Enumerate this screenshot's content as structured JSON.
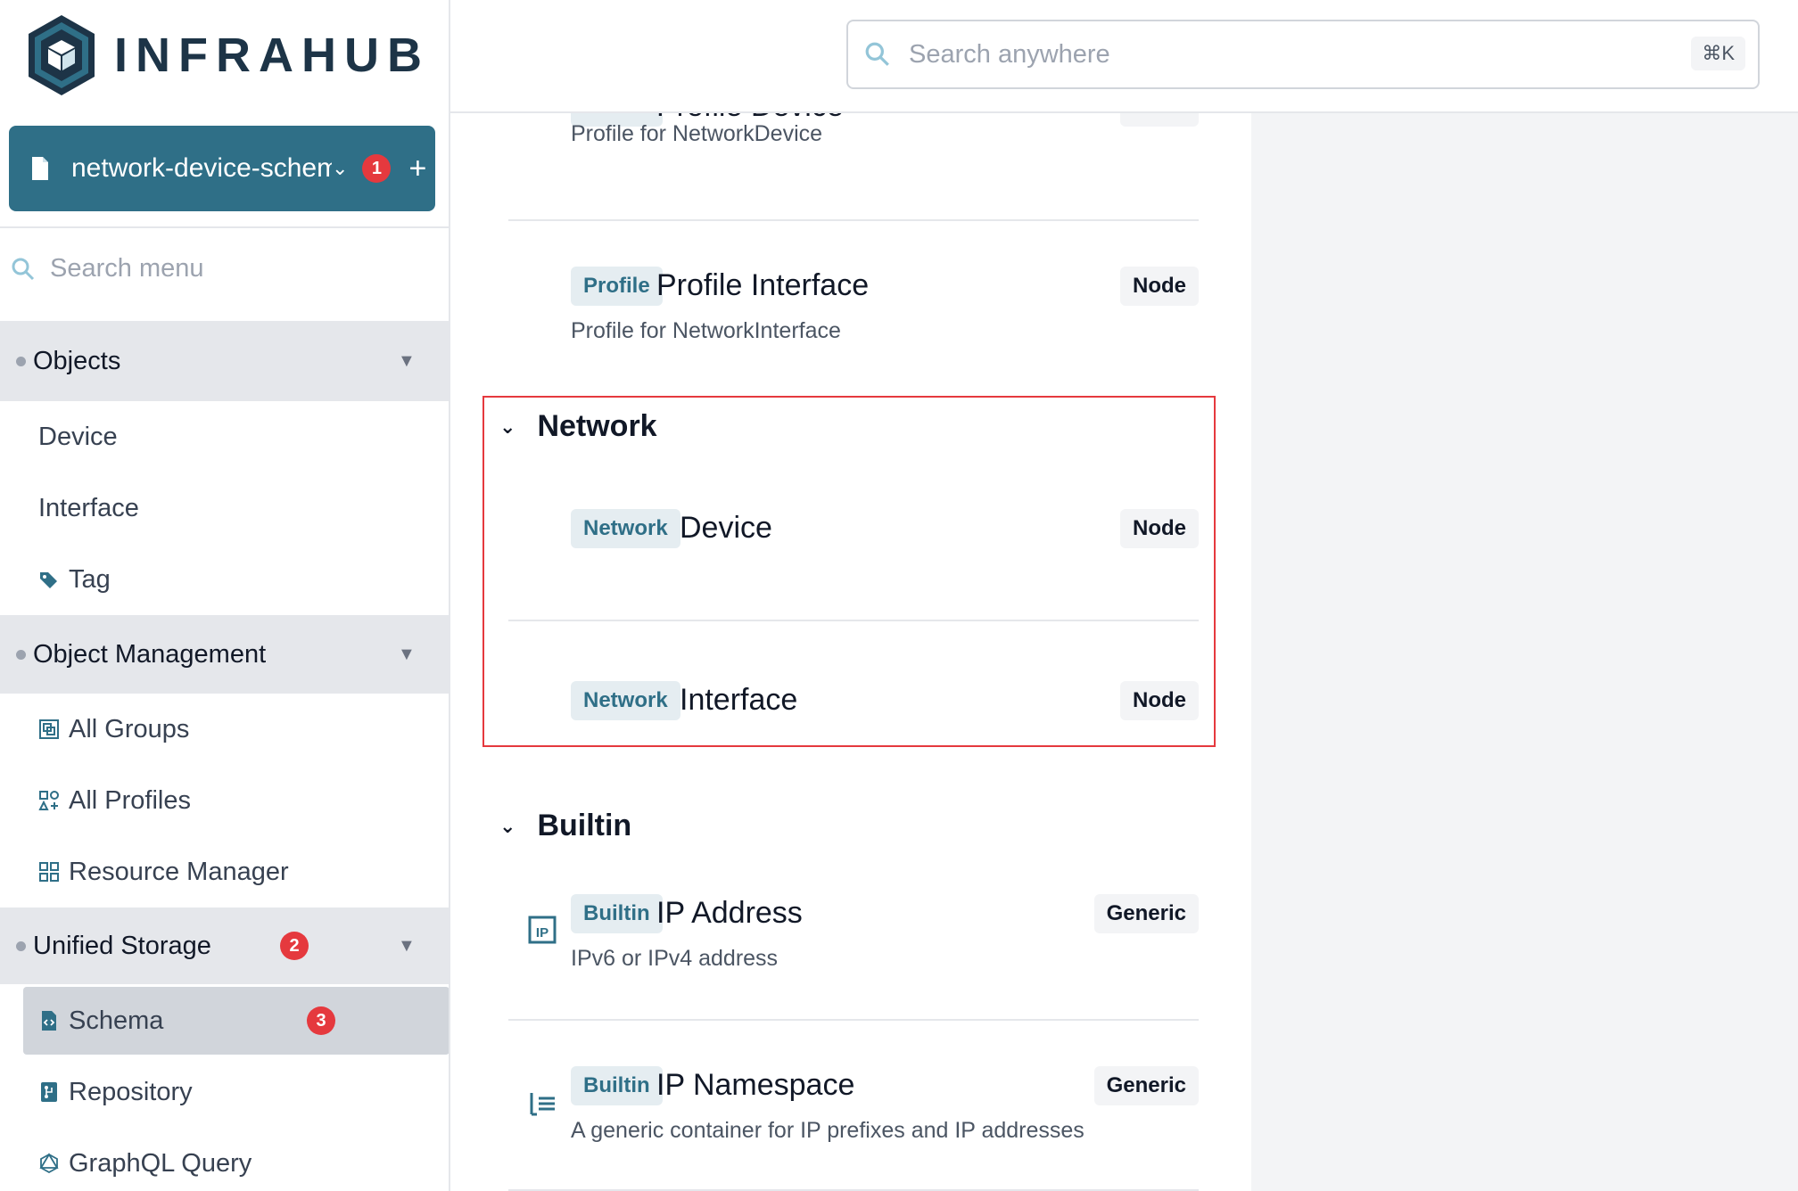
{
  "brand": {
    "name": "INFRAHUB"
  },
  "branch": {
    "name": "network-device-schema",
    "badge": "1",
    "add_label": "+"
  },
  "sidebar": {
    "search_placeholder": "Search menu",
    "groups": [
      {
        "label": "Objects",
        "items": [
          {
            "label": "Device"
          },
          {
            "label": "Interface"
          },
          {
            "label": "Tag"
          }
        ]
      },
      {
        "label": "Object Management",
        "items": [
          {
            "label": "All Groups"
          },
          {
            "label": "All Profiles"
          },
          {
            "label": "Resource Manager"
          }
        ]
      },
      {
        "label": "Unified Storage",
        "badge": "2",
        "items": [
          {
            "label": "Schema",
            "badge": "3"
          },
          {
            "label": "Repository"
          },
          {
            "label": "GraphQL Query"
          }
        ]
      }
    ]
  },
  "topbar": {
    "search_placeholder": "Search anywhere",
    "shortcut": "⌘K"
  },
  "schema_list": {
    "profile_rows": [
      {
        "namespace": "Profile",
        "name": "Profile Device",
        "kind": "Node",
        "description": "Profile for NetworkDevice"
      },
      {
        "namespace": "Profile",
        "name": "Profile Interface",
        "kind": "Node",
        "description": "Profile for NetworkInterface"
      }
    ],
    "sections": [
      {
        "title": "Network",
        "rows": [
          {
            "namespace": "Network",
            "name": "Device",
            "kind": "Node"
          },
          {
            "namespace": "Network",
            "name": "Interface",
            "kind": "Node"
          }
        ]
      },
      {
        "title": "Builtin",
        "rows": [
          {
            "namespace": "Builtin",
            "name": "IP Address",
            "kind": "Generic",
            "description": "IPv6 or IPv4 address",
            "icon": "ip-address-icon"
          },
          {
            "namespace": "Builtin",
            "name": "IP Namespace",
            "kind": "Generic",
            "description": "A generic container for IP prefixes and IP addresses",
            "icon": "list-icon"
          }
        ]
      }
    ]
  },
  "colors": {
    "accent": "#2f6f87",
    "badge": "#e5393e",
    "highlight": "#e5393e"
  }
}
